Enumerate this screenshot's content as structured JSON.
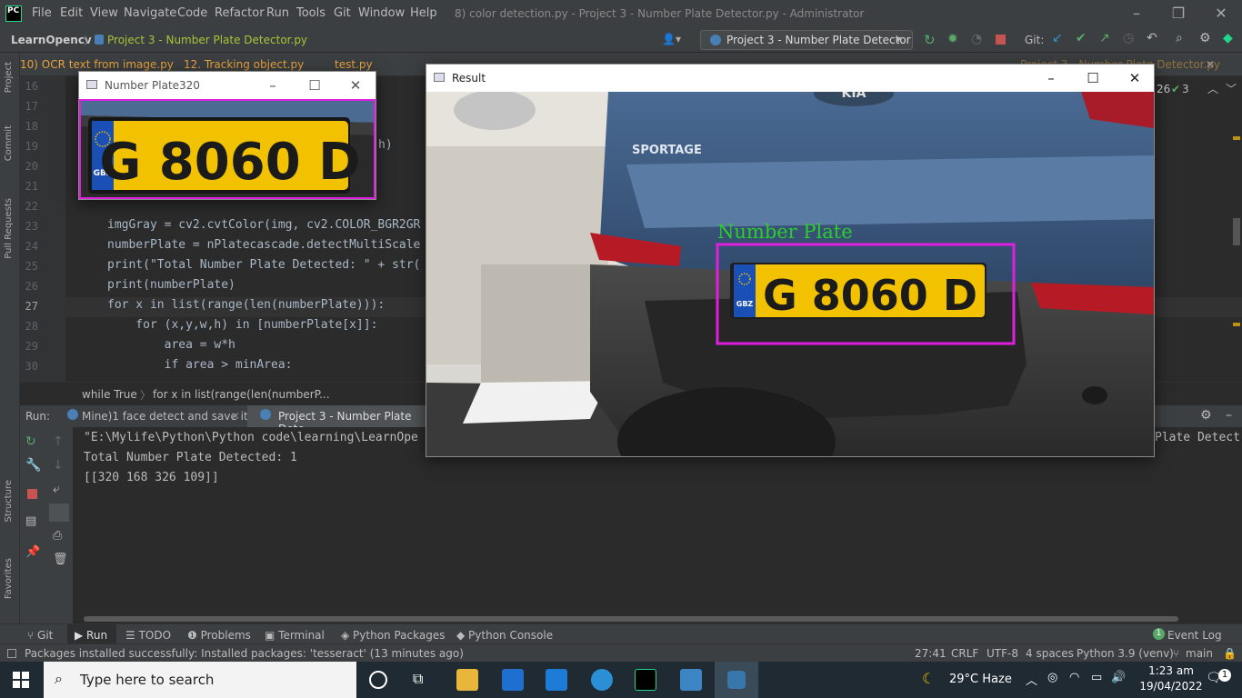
{
  "titlebar": {
    "logo_text": "PC",
    "menus": [
      "File",
      "Edit",
      "View",
      "Navigate",
      "Code",
      "Refactor",
      "Run",
      "Tools",
      "Git",
      "Window",
      "Help"
    ],
    "title": "8) color detection.py - Project 3 -  Number Plate Detector.py - Administrator"
  },
  "navbar": {
    "project": "LearnOpencv",
    "file": "Project 3 -  Number Plate Detector.py",
    "run_config": "Project 3 -  Number Plate Detector",
    "git_label": "Git:"
  },
  "tabs": [
    "10) OCR text from image.py",
    "12. Tracking object.py",
    "test.py",
    "Project 3 -  Number Plate Detector.py"
  ],
  "inspection": {
    "warnings": "26",
    "ok": "3"
  },
  "left_stripe": [
    "Project",
    "Commit",
    "Pull Requests",
    "Structure",
    "Favorites"
  ],
  "editor": {
    "lines": [
      {
        "num": "16",
        "code": ""
      },
      {
        "num": "17",
        "code": ""
      },
      {
        "num": "18",
        "code": ""
      },
      {
        "num": "19",
        "code": "h)"
      },
      {
        "num": "20",
        "code": ""
      },
      {
        "num": "21",
        "code": ""
      },
      {
        "num": "22",
        "code": ""
      },
      {
        "num": "23",
        "code": "imgGray = cv2.cvtColor(img, cv2.COLOR_BGR2GR"
      },
      {
        "num": "24",
        "code": "numberPlate = nPlatecascade.detectMultiScale"
      },
      {
        "num": "25",
        "code": "print(\"Total Number Plate Detected: \" + str("
      },
      {
        "num": "26",
        "code": "print(numberPlate)"
      },
      {
        "num": "27",
        "code": "for x in list(range(len(numberPlate))):"
      },
      {
        "num": "28",
        "code": "    for (x,y,w,h) in [numberPlate[x]]:"
      },
      {
        "num": "29",
        "code": "        area = w*h"
      },
      {
        "num": "30",
        "code": "        if area > minArea:"
      }
    ],
    "breadcrumb": [
      "while True",
      "for x in list(range(len(numberP..."
    ]
  },
  "run": {
    "label": "Run:",
    "tabs": [
      "Mine)1 face detect and save it",
      "Project 3 -  Number Plate Dete"
    ],
    "output": [
      "\"E:\\Mylife\\Python\\Python code\\learning\\LearnOpe",
      "Total Number Plate Detected: 1",
      "[[320 168 326 109]]"
    ],
    "overflow_text": "Plate Detect"
  },
  "window_small": {
    "title": "Number Plate320",
    "plate_text": "G 8060 D",
    "plate_badge": "GBZ"
  },
  "window_result": {
    "title": "Result",
    "detection_label": "Number Plate",
    "plate_text": "G 8060 D",
    "plate_badge": "GBZ",
    "car_badge": "SPORTAGE",
    "car_brand": "KIA"
  },
  "tool_tabs": [
    "Git",
    "Run",
    "TODO",
    "Problems",
    "Terminal",
    "Python Packages",
    "Python Console",
    "Event Log"
  ],
  "event_log_count": "1",
  "status": {
    "message": "Packages installed successfully: Installed packages: 'tesseract' (13 minutes ago)",
    "position": "27:41",
    "line_ending": "CRLF",
    "encoding": "UTF-8",
    "indent": "4 spaces",
    "interpreter": "Python 3.9 (venv)",
    "branch": "main"
  },
  "taskbar": {
    "search_placeholder": "Type here to search",
    "weather": "29°C  Haze",
    "time": "1:23 am",
    "date": "19/04/2022",
    "notifications": "1"
  },
  "colors": {
    "detection_box": "#e01ee0",
    "detection_label": "#2ecc2e",
    "plate_yellow": "#f2c200",
    "ide_bg": "#2b2b2b",
    "ide_panel": "#3c3f41"
  }
}
